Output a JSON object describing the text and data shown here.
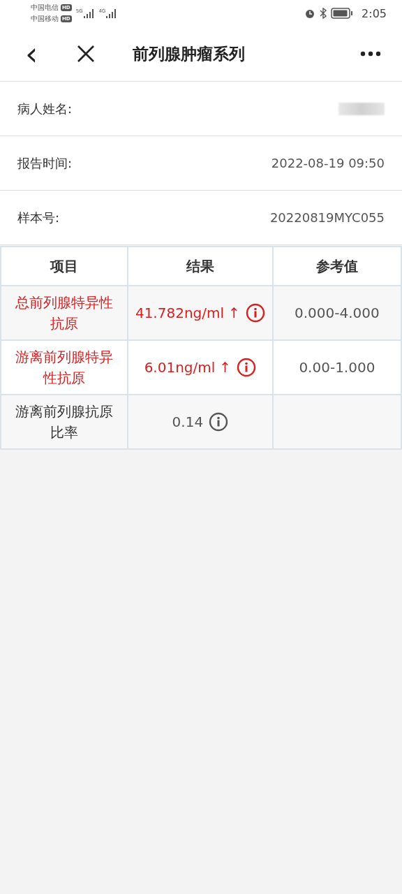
{
  "status_bar": {
    "carriers": [
      "中国电信",
      "中国移动"
    ],
    "hd": [
      "HD",
      "HD"
    ],
    "net": [
      "5G",
      "4G"
    ],
    "time": "2:05"
  },
  "header": {
    "back": "‹",
    "title": "前列腺肿瘤系列"
  },
  "info": [
    {
      "label": "病人姓名:",
      "kind": "redacted"
    },
    {
      "label": "报告时间:",
      "value": "2022-08-19 09:50",
      "kind": "text"
    },
    {
      "label": "样本号:",
      "value": "20220819MYC055",
      "kind": "text"
    }
  ],
  "table": {
    "columns": [
      "项目",
      "结果",
      "参考值"
    ],
    "rows": [
      {
        "item": "总前列腺特异性抗原",
        "result": "41.782ng/ml",
        "flag": "↑",
        "abnormal": true,
        "reference": "0.000-4.000"
      },
      {
        "item": "游离前列腺特异性抗原",
        "result": "6.01ng/ml",
        "flag": "↑",
        "abnormal": true,
        "reference": "0.00-1.000"
      },
      {
        "item": "游离前列腺抗原比率",
        "result": "0.14",
        "abnormal": false
      }
    ]
  }
}
